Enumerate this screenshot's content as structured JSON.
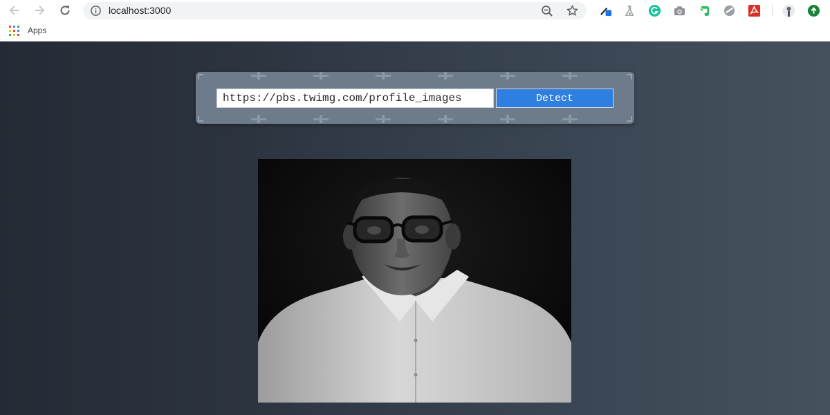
{
  "browser": {
    "url": "localhost:3000",
    "bookmarks": {
      "apps_label": "Apps"
    },
    "icons": {
      "back": "arrow-left-icon",
      "forward": "arrow-right-icon",
      "reload": "reload-icon",
      "info": "info-icon",
      "zoom": "zoom-out-icon",
      "star": "star-icon",
      "profile": "avatar"
    },
    "colors": {
      "accent": "#1a73e8",
      "grammarly": "#15c39a",
      "evernote": "#2dbe60"
    }
  },
  "page": {
    "url_input": {
      "value": "https://pbs.twimg.com/profile_images"
    },
    "detect_button": {
      "label": "Detect"
    },
    "colors": {
      "panel": "#6d7b8b",
      "button": "#2f7fe0",
      "background_left": "#252b35",
      "background_right": "#46515e"
    }
  }
}
